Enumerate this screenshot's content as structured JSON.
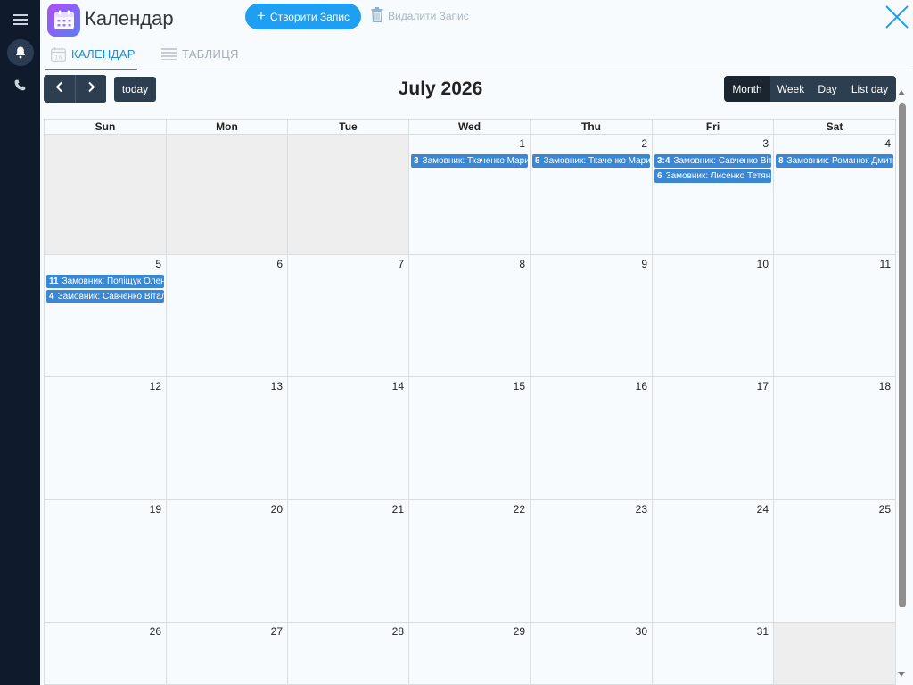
{
  "app": {
    "title": "Календар"
  },
  "header": {
    "create_label": "Створити Запис",
    "delete_label": "Видалити Запис"
  },
  "tabs": [
    {
      "label": "КАЛЕНДАР",
      "active": true
    },
    {
      "label": "ТАБЛИЦЯ",
      "active": false
    }
  ],
  "toolbar": {
    "title": "July 2026",
    "today_label": "today",
    "views": [
      "Month",
      "Week",
      "Day",
      "List day"
    ],
    "active_view": "Month"
  },
  "calendar": {
    "weekdays": [
      "Sun",
      "Mon",
      "Tue",
      "Wed",
      "Thu",
      "Fri",
      "Sat"
    ],
    "weeks": [
      [
        {
          "day": "",
          "other": true,
          "events": []
        },
        {
          "day": "",
          "other": true,
          "events": []
        },
        {
          "day": "",
          "other": true,
          "events": []
        },
        {
          "day": "1",
          "other": false,
          "events": [
            {
              "time": "3",
              "title": "Замовник: Ткаченко Марина"
            }
          ]
        },
        {
          "day": "2",
          "other": false,
          "events": [
            {
              "time": "5",
              "title": "Замовник: Ткаченко Марина"
            }
          ]
        },
        {
          "day": "3",
          "other": false,
          "events": [
            {
              "time": "3:4",
              "title": "Замовник: Савченко Віталій"
            },
            {
              "time": "6",
              "title": "Замовник: Лисенко Тетяна"
            }
          ]
        },
        {
          "day": "4",
          "other": false,
          "events": [
            {
              "time": "8",
              "title": "Замовник: Романюк Дмитро"
            }
          ]
        }
      ],
      [
        {
          "day": "5",
          "other": false,
          "events": [
            {
              "time": "11",
              "title": "Замовник: Поліщук Олена"
            },
            {
              "time": "4",
              "title": "Замовник: Савченко Віталій"
            }
          ]
        },
        {
          "day": "6",
          "other": false,
          "events": []
        },
        {
          "day": "7",
          "other": false,
          "events": []
        },
        {
          "day": "8",
          "other": false,
          "events": []
        },
        {
          "day": "9",
          "other": false,
          "events": []
        },
        {
          "day": "10",
          "other": false,
          "events": []
        },
        {
          "day": "11",
          "other": false,
          "events": []
        }
      ],
      [
        {
          "day": "12",
          "other": false,
          "events": []
        },
        {
          "day": "13",
          "other": false,
          "events": []
        },
        {
          "day": "14",
          "other": false,
          "events": []
        },
        {
          "day": "15",
          "other": false,
          "events": []
        },
        {
          "day": "16",
          "other": false,
          "events": []
        },
        {
          "day": "17",
          "other": false,
          "events": []
        },
        {
          "day": "18",
          "other": false,
          "events": []
        }
      ],
      [
        {
          "day": "19",
          "other": false,
          "events": []
        },
        {
          "day": "20",
          "other": false,
          "events": []
        },
        {
          "day": "21",
          "other": false,
          "events": []
        },
        {
          "day": "22",
          "other": false,
          "events": []
        },
        {
          "day": "23",
          "other": false,
          "events": []
        },
        {
          "day": "24",
          "other": false,
          "events": []
        },
        {
          "day": "25",
          "other": false,
          "events": []
        }
      ],
      [
        {
          "day": "26",
          "other": false,
          "events": []
        },
        {
          "day": "27",
          "other": false,
          "events": []
        },
        {
          "day": "28",
          "other": false,
          "events": []
        },
        {
          "day": "29",
          "other": false,
          "events": []
        },
        {
          "day": "30",
          "other": false,
          "events": []
        },
        {
          "day": "31",
          "other": false,
          "events": []
        },
        {
          "day": "",
          "other": true,
          "events": []
        }
      ]
    ]
  },
  "colors": {
    "rail": "#0f1b2d",
    "primary": "#1e9ff2",
    "toolbar_button": "#2c3e50",
    "event": "#3a87d6"
  },
  "icons": {
    "menu": "hamburger-icon",
    "bell": "bell-icon",
    "phone": "phone-icon",
    "app": "calendar-app-icon",
    "delete": "trash-icon",
    "close": "close-icon"
  }
}
